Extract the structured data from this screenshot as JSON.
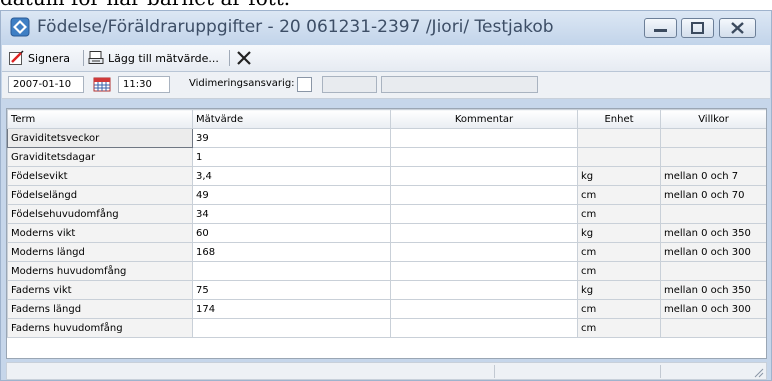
{
  "background_text": "datum för när barnet är fött.",
  "window": {
    "title": "Födelse/Föräldraruppgifter -  20 061231-2397 /Jiori/ Testjakob"
  },
  "toolbar": {
    "sign_label": "Signera",
    "add_value_label": "Lägg till mätvärde..."
  },
  "datebar": {
    "date": "2007-01-10",
    "time": "11:30",
    "vidimering_label": "Vidimeringsansvarig:"
  },
  "table": {
    "columns": [
      "Term",
      "Mätvärde",
      "Kommentar",
      "Enhet",
      "Villkor"
    ],
    "rows": [
      {
        "term": "Graviditetsveckor",
        "value": "39",
        "comment": "",
        "unit": "",
        "condition": ""
      },
      {
        "term": "Graviditetsdagar",
        "value": "1",
        "comment": "",
        "unit": "",
        "condition": ""
      },
      {
        "term": "Födelsevikt",
        "value": "3,4",
        "comment": "",
        "unit": "kg",
        "condition": "mellan 0 och 7"
      },
      {
        "term": "Födelselängd",
        "value": "49",
        "comment": "",
        "unit": "cm",
        "condition": "mellan 0 och 70"
      },
      {
        "term": "Födelsehuvudomfång",
        "value": "34",
        "comment": "",
        "unit": "cm",
        "condition": ""
      },
      {
        "term": "Moderns vikt",
        "value": "60",
        "comment": "",
        "unit": "kg",
        "condition": "mellan 0 och 350"
      },
      {
        "term": "Moderns längd",
        "value": "168",
        "comment": "",
        "unit": "cm",
        "condition": "mellan 0 och 300"
      },
      {
        "term": "Moderns huvudomfång",
        "value": "",
        "comment": "",
        "unit": "cm",
        "condition": ""
      },
      {
        "term": "Faderns vikt",
        "value": "75",
        "comment": "",
        "unit": "kg",
        "condition": "mellan 0 och 350"
      },
      {
        "term": "Faderns längd",
        "value": "174",
        "comment": "",
        "unit": "cm",
        "condition": "mellan 0 och 300"
      },
      {
        "term": "Faderns huvudomfång",
        "value": "",
        "comment": "",
        "unit": "cm",
        "condition": ""
      }
    ]
  }
}
